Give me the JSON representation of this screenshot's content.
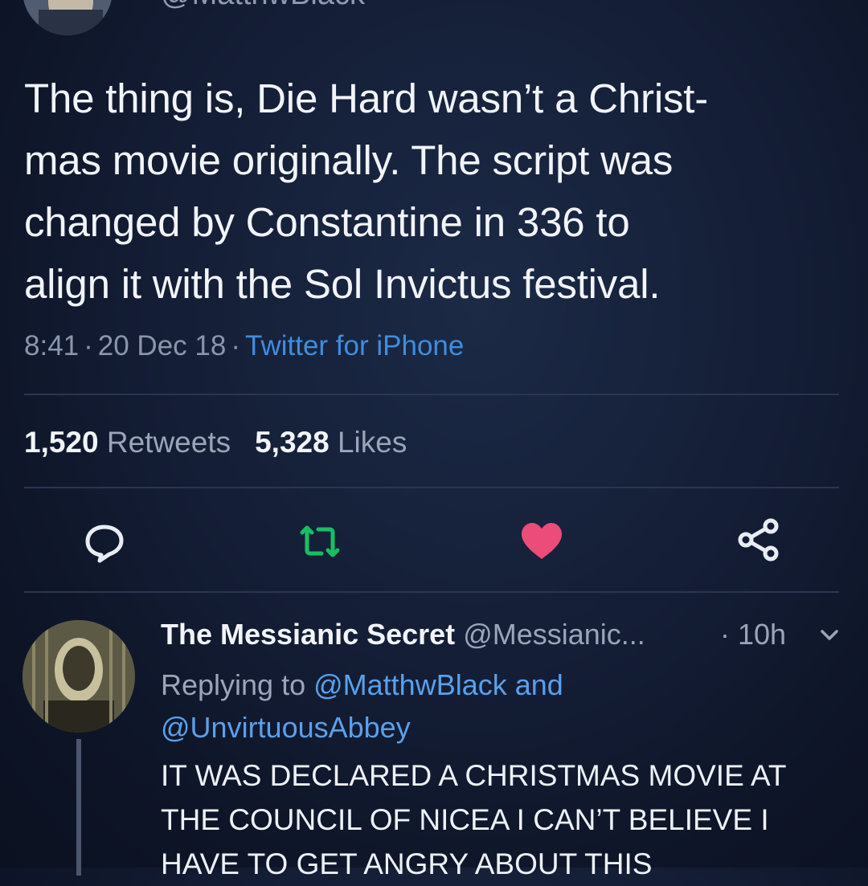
{
  "header": {
    "handle": "@MatthwBlack"
  },
  "tweet": {
    "text_lines": [
      "The thing is, Die Hard wasn’t a Christ-",
      "mas movie originally. The script was",
      "changed by Constantine in 336 to",
      "align it with the Sol Invictus festival."
    ],
    "time": "8:41",
    "date": "20 Dec 18",
    "separator": "·",
    "source": "Twitter for iPhone",
    "retweets_count": "1,520",
    "retweets_label": "Retweets",
    "likes_count": "5,328",
    "likes_label": "Likes"
  },
  "actions": {
    "reply_icon": "reply-icon",
    "retweet_icon": "retweet-icon",
    "like_icon": "heart-icon",
    "share_icon": "share-icon",
    "retweet_color": "#17bf63",
    "like_color": "#e0245e"
  },
  "reply": {
    "name": "The Messianic Secret",
    "handle": "@Messianic...",
    "time": "· 10h",
    "replying_prefix": "Replying to",
    "mention_1": "@MatthwBlack",
    "and": "and",
    "mention_2": "@UnvirtuousAbbey",
    "text_lines": [
      "IT WAS DECLARED A CHRISTMAS MOVIE AT",
      "THE COUNCIL OF NICEA I CAN’T BELIEVE I",
      "HAVE TO GET ANGRY ABOUT THIS"
    ]
  },
  "colors": {
    "background": "#141e36",
    "link": "#3f8de0",
    "muted": "#8a96ab"
  }
}
